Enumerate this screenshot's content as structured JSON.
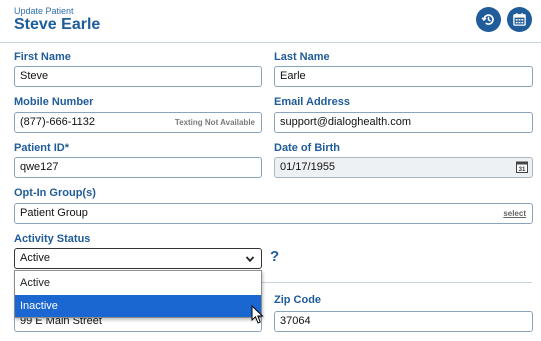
{
  "header": {
    "subtitle": "Update Patient",
    "title": "Steve Earle",
    "history_icon": "history-icon",
    "calendar_icon": "calendar-icon",
    "button_color": "#1f5c99"
  },
  "form": {
    "first_name": {
      "label": "First Name",
      "value": "Steve"
    },
    "last_name": {
      "label": "Last Name",
      "value": "Earle"
    },
    "mobile_number": {
      "label": "Mobile Number",
      "value": "(877)-666-1132",
      "hint": "Texting Not Available"
    },
    "email_address": {
      "label": "Email Address",
      "value": "support@dialoghealth.com"
    },
    "patient_id": {
      "label": "Patient ID*",
      "value": "qwe127"
    },
    "date_of_birth": {
      "label": "Date of Birth",
      "value": "01/17/1955",
      "icon": "calendar-picker-icon"
    },
    "optin_groups": {
      "label": "Opt-In Group(s)",
      "value": "Patient Group",
      "select_label": "select"
    },
    "activity_status": {
      "label": "Activity Status",
      "value": "Active",
      "help": "?",
      "options": [
        "Active",
        "Inactive"
      ],
      "highlighted": "Inactive"
    },
    "address": {
      "value": "99 E Main Street"
    },
    "zip_code": {
      "label": "Zip Code",
      "value": "37064"
    }
  },
  "colors": {
    "accent": "#1f5c99",
    "dropdown_highlight": "#1a67d2"
  }
}
